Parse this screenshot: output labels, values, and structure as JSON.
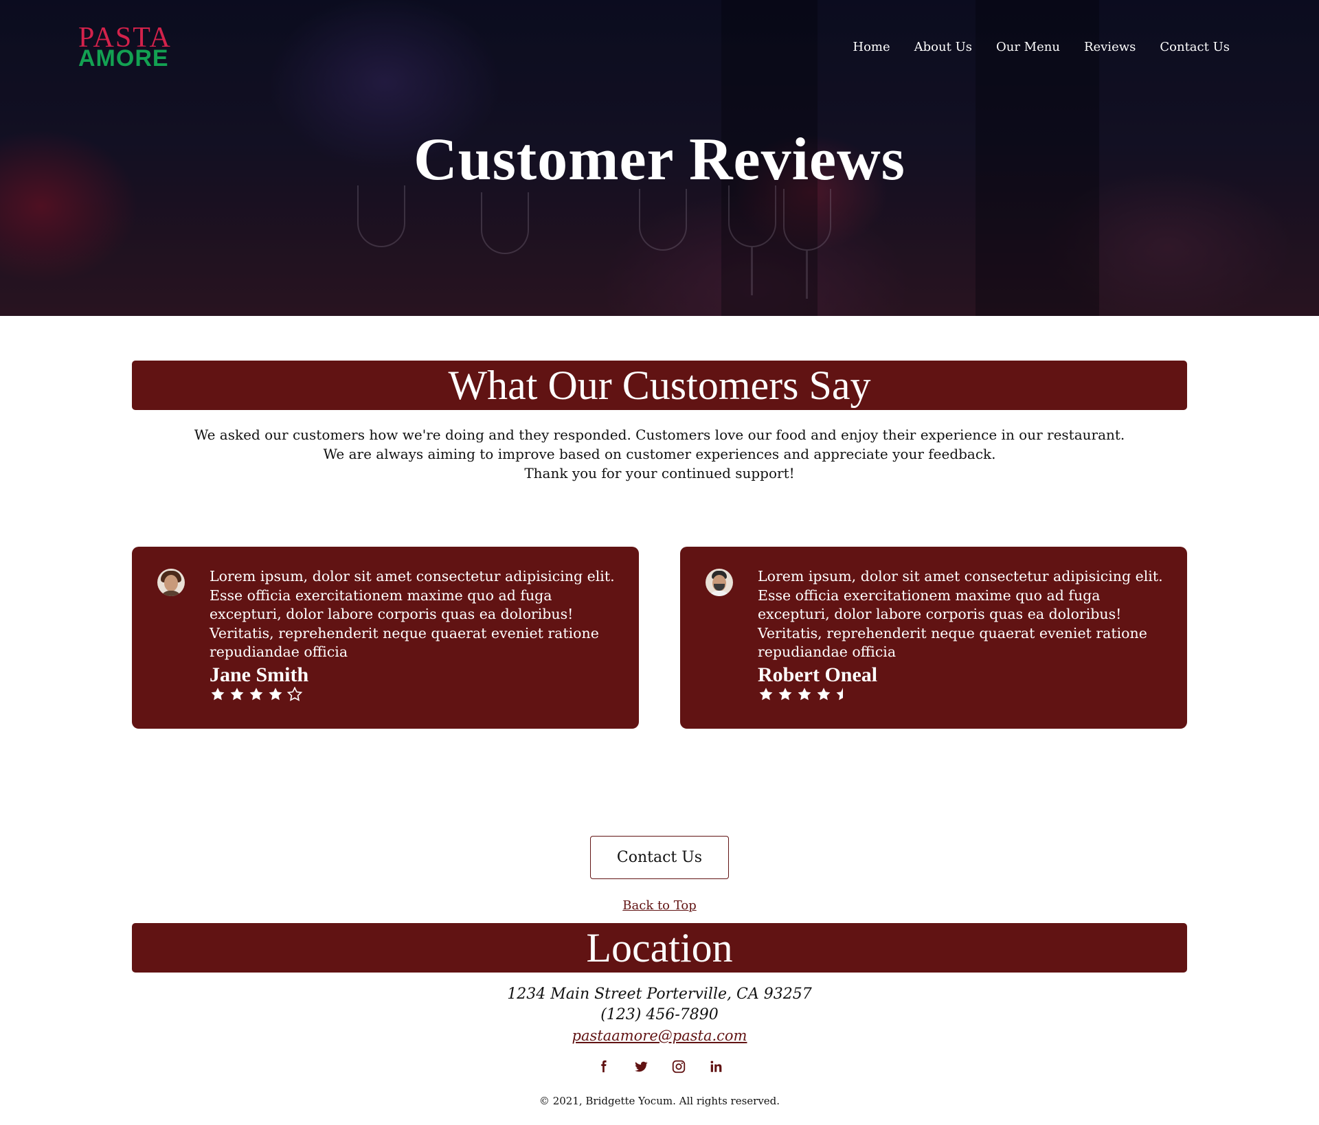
{
  "logo": {
    "top": "PASTA",
    "bottom": "AMORE"
  },
  "nav": [
    {
      "label": "Home"
    },
    {
      "label": "About Us"
    },
    {
      "label": "Our Menu"
    },
    {
      "label": "Reviews"
    },
    {
      "label": "Contact Us"
    }
  ],
  "hero": {
    "title": "Customer Reviews"
  },
  "section_reviews": {
    "heading": "What Our Customers Say",
    "intro": [
      "We asked our customers how we're doing and they responded. Customers love our food and enjoy their experience in our restaurant.",
      "We are always aiming to improve based on customer experiences and appreciate your feedback.",
      "Thank you for your continued support!"
    ]
  },
  "reviews": [
    {
      "text": "Lorem ipsum, dolor sit amet consectetur adipisicing elit. Esse officia exercitationem maxime quo ad fuga excepturi, dolor labore corporis quas ea doloribus! Veritatis, reprehenderit neque quaerat eveniet ratione repudiandae officia",
      "name": "Jane Smith",
      "rating": 4
    },
    {
      "text": "Lorem ipsum, dolor sit amet consectetur adipisicing elit. Esse officia exercitationem maxime quo ad fuga excepturi, dolor labore corporis quas ea doloribus! Veritatis, reprehenderit neque quaerat eveniet ratione repudiandae officia",
      "name": "Robert Oneal",
      "rating": 4.5
    }
  ],
  "cta": {
    "contact_label": "Contact Us",
    "back_to_top": "Back to Top"
  },
  "location": {
    "heading": "Location",
    "address": "1234 Main Street Porterville, CA 93257",
    "phone": "(123) 456-7890",
    "email": "pastaamore@pasta.com"
  },
  "socials": [
    "facebook-icon",
    "twitter-icon",
    "instagram-icon",
    "linkedin-icon"
  ],
  "footer": {
    "copyright": "© 2021, Bridgette Yocum. All rights reserved."
  },
  "colors": {
    "brand": "#611313",
    "logo_red": "#d3224b",
    "logo_green": "#13a152"
  }
}
